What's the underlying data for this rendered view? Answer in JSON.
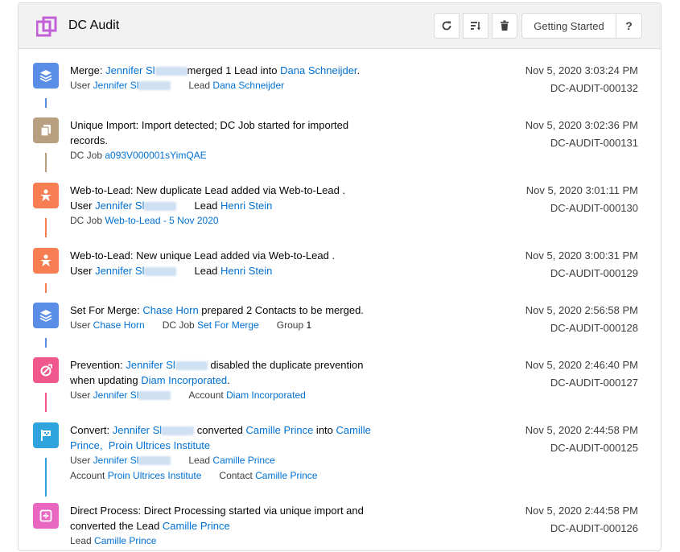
{
  "header": {
    "title": "DC Audit",
    "getting_started_label": "Getting Started",
    "help_label": "?"
  },
  "colors": {
    "blue_icon": "#5a8ee6",
    "tan_icon": "#b89f7f",
    "orange_icon": "#f77e52",
    "pink_icon": "#f0578c",
    "sky_icon": "#2ea3dd",
    "magenta_icon": "#e767c1",
    "link": "#0070d2"
  },
  "entries": [
    {
      "icon": "layers-icon",
      "line1": {
        "prefix": "Merge: ",
        "user": "Jennifer Sl",
        "mid": "merged 1 Lead into ",
        "target": "Dana Schneijder",
        "suffix": "."
      },
      "meta1": {
        "user_label": "User ",
        "user": "Jennifer Sl",
        "lead_label": "Lead ",
        "lead": "Dana Schneijder"
      },
      "date": "Nov 5, 2020 3:03:24 PM",
      "code": "DC-AUDIT-000132"
    },
    {
      "icon": "copy-icon",
      "line1": "Unique Import: Import detected; DC Job started for imported",
      "line2": "records.",
      "meta1": {
        "job_label": "DC Job ",
        "job": "a093V000001sYimQAE"
      },
      "date": "Nov 5, 2020 3:02:36 PM",
      "code": "DC-AUDIT-000131"
    },
    {
      "icon": "person-star-icon",
      "line1": "Web-to-Lead: New duplicate Lead added via Web-to-Lead .",
      "line2": {
        "user_label": "User ",
        "user": "Jennifer Sl",
        "lead_label": "Lead ",
        "lead": "Henri Stein"
      },
      "meta1": {
        "job_label": "DC Job ",
        "job": "Web-to-Lead - 5 Nov 2020"
      },
      "date": "Nov 5, 2020 3:01:11 PM",
      "code": "DC-AUDIT-000130"
    },
    {
      "icon": "person-star-icon",
      "line1": "Web-to-Lead: New unique Lead added via Web-to-Lead .",
      "line2": {
        "user_label": "User ",
        "user": "Jennifer Sl",
        "lead_label": "Lead ",
        "lead": "Henri Stein"
      },
      "date": "Nov 5, 2020 3:00:31 PM",
      "code": "DC-AUDIT-000129"
    },
    {
      "icon": "layers-icon",
      "line1": {
        "prefix": "Set For Merge: ",
        "user": "Chase Horn",
        "suffix": " prepared 2 Contacts to be merged."
      },
      "meta1": {
        "user_label": "User ",
        "user": "Chase Horn",
        "job_label": "DC Job ",
        "job": "Set For Merge",
        "group_label": "Group ",
        "group": "1"
      },
      "date": "Nov 5, 2020 2:56:58 PM",
      "code": "DC-AUDIT-000128"
    },
    {
      "icon": "prevention-icon",
      "line1": {
        "prefix": "Prevention: ",
        "user": "Jennifer Sl",
        "suffix": " disabled the duplicate prevention"
      },
      "line2": {
        "prefix": "when updating ",
        "account": "Diam Incorporated",
        "suffix": "."
      },
      "meta1": {
        "user_label": "User ",
        "user": "Jennifer Sl",
        "account_label": "Account ",
        "account": "Diam Incorporated"
      },
      "date": "Nov 5, 2020 2:46:40 PM",
      "code": "DC-AUDIT-000127"
    },
    {
      "icon": "flag-icon",
      "line1": {
        "prefix": "Convert: ",
        "user": "Jennifer Sl",
        "mid": " converted ",
        "from": "Camille Prince",
        "into": " into ",
        "to": "Camille"
      },
      "line2": {
        "to2": "Prince,",
        "company": "Proin Ultrices Institute"
      },
      "meta1": {
        "user_label": "User ",
        "user": "Jennifer Sl",
        "lead_label": "Lead ",
        "lead": "Camille Prince"
      },
      "meta2": {
        "account_label": "Account ",
        "account": "Proin Ultrices Institute",
        "contact_label": "Contact ",
        "contact": "Camille Prince"
      },
      "date": "Nov 5, 2020 2:44:58 PM",
      "code": "DC-AUDIT-000125"
    },
    {
      "icon": "process-icon",
      "line1": "Direct Process: Direct Processing started via unique import and",
      "line2": {
        "prefix": "converted the Lead ",
        "lead": "Camille Prince"
      },
      "meta1": {
        "lead_label": "Lead ",
        "lead": "Camille Prince"
      },
      "date": "Nov 5, 2020 2:44:58 PM",
      "code": "DC-AUDIT-000126"
    }
  ]
}
